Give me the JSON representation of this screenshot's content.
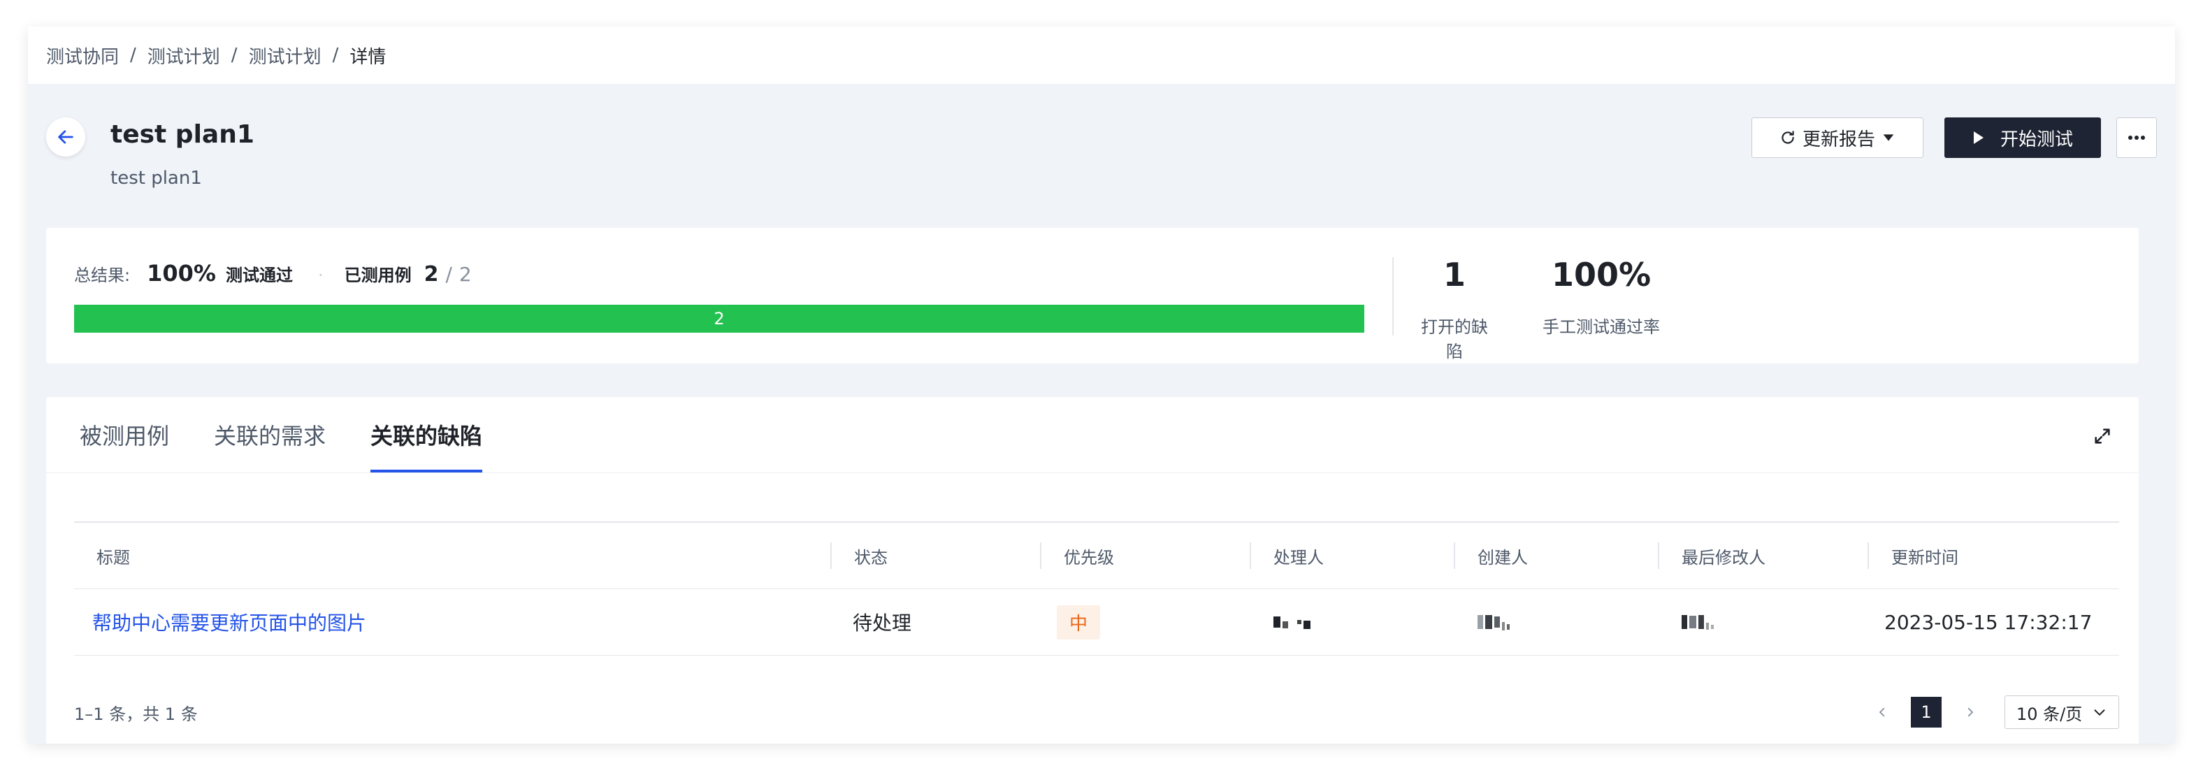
{
  "breadcrumb": [
    "测试协同",
    "测试计划",
    "测试计划",
    "详情"
  ],
  "plan": {
    "title": "test plan1",
    "subtitle": "test plan1"
  },
  "actions": {
    "update_report": "更新报告",
    "start_test": "开始测试",
    "more": "···"
  },
  "summary": {
    "result_label": "总结果:",
    "pass_percent": "100%",
    "pass_label": "测试通过",
    "dot": "·",
    "cases_label": "已测用例",
    "cases_done": "2",
    "cases_sep": "/",
    "cases_total": "2",
    "progress_fraction": 1.0,
    "progress_label": "2",
    "open_defects_value": "1",
    "open_defects_label": "打开的缺陷",
    "manual_pass_rate_value": "100%",
    "manual_pass_rate_label": "手工测试通过率"
  },
  "tabs": [
    {
      "label": "被测用例",
      "active": false
    },
    {
      "label": "关联的需求",
      "active": false
    },
    {
      "label": "关联的缺陷",
      "active": true
    }
  ],
  "table": {
    "headers": [
      "标题",
      "状态",
      "优先级",
      "处理人",
      "创建人",
      "最后修改人",
      "更新时间"
    ],
    "rows": [
      {
        "title": "帮助中心需要更新页面中的图片",
        "status": "待处理",
        "priority": "中",
        "updated": "2023-05-15 17:32:17"
      }
    ]
  },
  "pagination": {
    "total_text": "1–1 条，共 1 条",
    "current_page": "1",
    "page_size": "10 条/页"
  },
  "colors": {
    "accent": "#2353e8",
    "dark_button": "#1e2433",
    "progress_green": "#23c150",
    "priority_orange": "#e8681a"
  },
  "icons": [
    "arrow-left-icon",
    "refresh-icon",
    "caret-down-icon",
    "play-icon",
    "more-icon",
    "expand-icon",
    "chevron-left-icon",
    "chevron-right-icon",
    "chevron-down-icon"
  ]
}
